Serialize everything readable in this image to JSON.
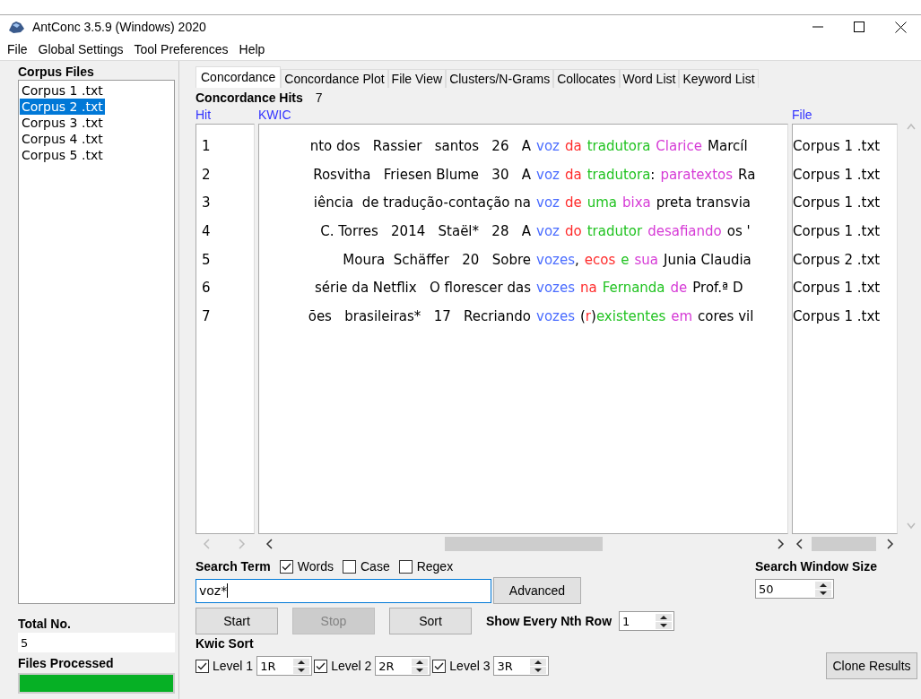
{
  "window": {
    "title": "AntConc 3.5.9 (Windows) 2020"
  },
  "menu": [
    "File",
    "Global Settings",
    "Tool Preferences",
    "Help"
  ],
  "corpus_files": {
    "title": "Corpus Files",
    "items": [
      {
        "label": "Corpus 1 .txt",
        "selected": false
      },
      {
        "label": "Corpus 2 .txt",
        "selected": true
      },
      {
        "label": "Corpus 3 .txt",
        "selected": false
      },
      {
        "label": "Corpus 4 .txt",
        "selected": false
      },
      {
        "label": "Corpus 5 .txt",
        "selected": false
      }
    ]
  },
  "total": {
    "label": "Total No.",
    "value": "5"
  },
  "files_processed": {
    "label": "Files Processed",
    "level": 1
  },
  "tabs": [
    {
      "label": "Concordance",
      "selected": true
    },
    {
      "label": "Concordance Plot",
      "selected": false
    },
    {
      "label": "File View",
      "selected": false
    },
    {
      "label": "Clusters/N-Grams",
      "selected": false
    },
    {
      "label": "Collocates",
      "selected": false
    },
    {
      "label": "Word List",
      "selected": false
    },
    {
      "label": "Keyword List",
      "selected": false
    }
  ],
  "hits": {
    "label": "Concordance Hits",
    "value": "7"
  },
  "table": {
    "columns": [
      "Hit",
      "KWIC",
      "File"
    ],
    "rows": [
      {
        "hit": "1",
        "left": "nto dos   Rassier   santos   26   A",
        "segments": [
          {
            "text": "voz",
            "kind": "key"
          },
          {
            "text": "da",
            "kind": "r1"
          },
          {
            "text": "tradutora",
            "kind": "r2"
          },
          {
            "text": "Clarice",
            "kind": "r3"
          }
        ],
        "right": "Marcíl",
        "file": "Corpus 1 .txt"
      },
      {
        "hit": "2",
        "left": "Rosvitha   Friesen Blume   30   A",
        "segments": [
          {
            "text": "voz",
            "kind": "key"
          },
          {
            "text": "da",
            "kind": "r1"
          },
          {
            "text": "tradutora",
            "kind": "r2"
          },
          {
            "text": ":",
            "kind": "plain",
            "join": true
          },
          {
            "text": "paratextos",
            "kind": "r3"
          }
        ],
        "right": "Ra",
        "file": "Corpus 1 .txt"
      },
      {
        "hit": "3",
        "left": "iência  de tradução-contação na",
        "segments": [
          {
            "text": "voz",
            "kind": "key"
          },
          {
            "text": "de",
            "kind": "r1"
          },
          {
            "text": "uma",
            "kind": "r2"
          },
          {
            "text": "bixa",
            "kind": "r3"
          }
        ],
        "right": "preta transvia",
        "file": "Corpus 1 .txt"
      },
      {
        "hit": "4",
        "left": "C. Torres   2014   Staël*   28   A",
        "segments": [
          {
            "text": "voz",
            "kind": "key"
          },
          {
            "text": "do",
            "kind": "r1"
          },
          {
            "text": "tradutor",
            "kind": "r2"
          },
          {
            "text": "desafiando",
            "kind": "r3"
          }
        ],
        "right": "os '",
        "file": "Corpus 1 .txt"
      },
      {
        "hit": "5",
        "left": "Moura  Schäffer   20   Sobre",
        "segments": [
          {
            "text": "vozes",
            "kind": "key"
          },
          {
            "text": ",",
            "kind": "plain",
            "join": true
          },
          {
            "text": "ecos",
            "kind": "r1"
          },
          {
            "text": "e",
            "kind": "r2"
          },
          {
            "text": "sua",
            "kind": "r3"
          }
        ],
        "right": "Junia Claudia",
        "file": "Corpus 2 .txt"
      },
      {
        "hit": "6",
        "left": "série da Netflix   O florescer das",
        "segments": [
          {
            "text": "vozes",
            "kind": "key"
          },
          {
            "text": "na",
            "kind": "r1"
          },
          {
            "text": "Fernanda",
            "kind": "r2"
          },
          {
            "text": "de",
            "kind": "r3"
          }
        ],
        "right": "Prof.ª D",
        "file": "Corpus 1 .txt"
      },
      {
        "hit": "7",
        "left": "ões   brasileiras*   17   Recriando",
        "segments": [
          {
            "text": "vozes",
            "kind": "key"
          },
          {
            "text": "(",
            "kind": "plain"
          },
          {
            "text": "r",
            "kind": "r1",
            "join": true
          },
          {
            "text": ")",
            "kind": "plain",
            "join": true
          },
          {
            "text": "existentes",
            "kind": "r2",
            "join": true
          },
          {
            "text": "em",
            "kind": "r3"
          }
        ],
        "right": "cores vil",
        "file": "Corpus 1 .txt"
      }
    ]
  },
  "search": {
    "label": "Search Term",
    "options": [
      {
        "label": "Words",
        "checked": true
      },
      {
        "label": "Case",
        "checked": false
      },
      {
        "label": "Regex",
        "checked": false
      }
    ],
    "value": "voz*",
    "advanced": "Advanced"
  },
  "buttons": [
    {
      "label": "Start",
      "disabled": false
    },
    {
      "label": "Stop",
      "disabled": true
    },
    {
      "label": "Sort",
      "disabled": false
    }
  ],
  "nth_row": {
    "label": "Show Every Nth Row",
    "value": "1"
  },
  "window_size": {
    "label": "Search Window Size",
    "value": "50"
  },
  "kwic_sort": {
    "label": "Kwic Sort",
    "levels": [
      {
        "label": "Level 1",
        "checked": true,
        "value": "1R"
      },
      {
        "label": "Level 2",
        "checked": true,
        "value": "2R"
      },
      {
        "label": "Level 3",
        "checked": true,
        "value": "3R"
      }
    ]
  },
  "clone": "Clone Results"
}
